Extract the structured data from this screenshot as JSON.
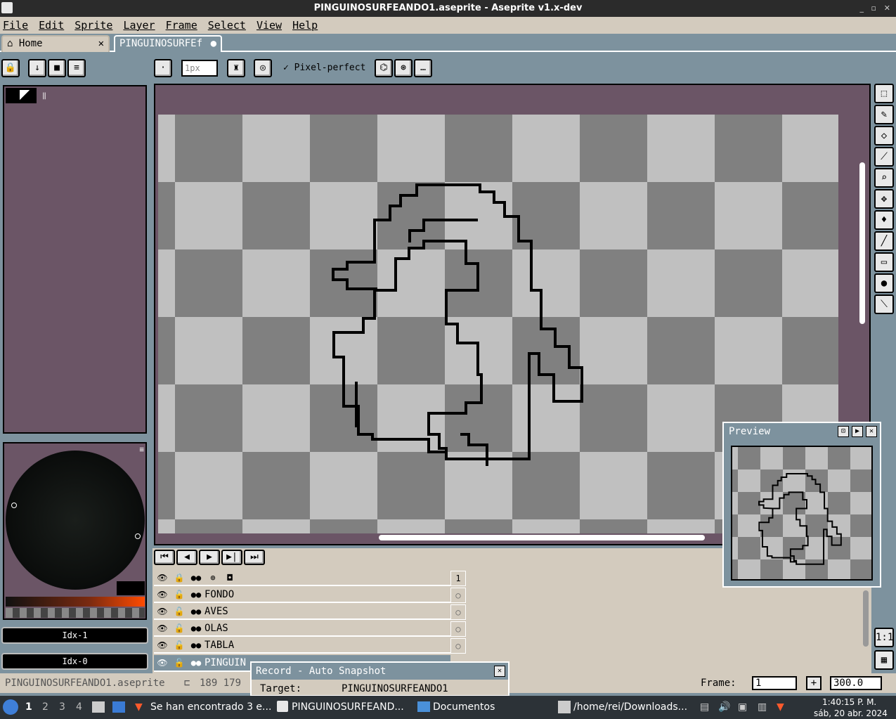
{
  "window": {
    "title": "PINGUINOSURFEANDO1.aseprite - Aseprite v1.x-dev"
  },
  "menu": [
    "File",
    "Edit",
    "Sprite",
    "Layer",
    "Frame",
    "Select",
    "View",
    "Help"
  ],
  "tabs": {
    "home": "Home",
    "file": "PINGUINOSURFEf"
  },
  "toolbar": {
    "brush_size": "1px",
    "pixel_perfect": "Pixel-perfect"
  },
  "color": {
    "fg": "Idx-1",
    "bg": "Idx-0"
  },
  "layers": [
    {
      "name": "FONDO"
    },
    {
      "name": "AVES"
    },
    {
      "name": "OLAS"
    },
    {
      "name": "TABLA"
    },
    {
      "name": "PINGUIN"
    }
  ],
  "timeline": {
    "frame_number": "1"
  },
  "preview": {
    "title": "Preview"
  },
  "record": {
    "title": "Record - Auto Snapshot",
    "target_label": "Target:",
    "target_value": "PINGUINOSURFEANDO1"
  },
  "status": {
    "filename": "PINGUINOSURFEANDO1.aseprite",
    "size": "189 179",
    "frame_label": "Frame:",
    "frame_value": "1",
    "zoom": "300.0"
  },
  "taskbar": {
    "workspaces": [
      "1",
      "2",
      "3",
      "4"
    ],
    "items": [
      "Se han encontrado 3 e...",
      "PINGUINOSURFEAND...",
      "Documentos",
      "/home/rei/Downloads..."
    ],
    "time": "1:40:15 P. M.",
    "date": "sáb, 20 abr. 2024"
  },
  "colors": {
    "panel": "#6b5566",
    "bg": "#7d929e",
    "chrome": "#d3cbbe",
    "checker_dark": "#808080",
    "checker_light": "#c0c0c0"
  }
}
